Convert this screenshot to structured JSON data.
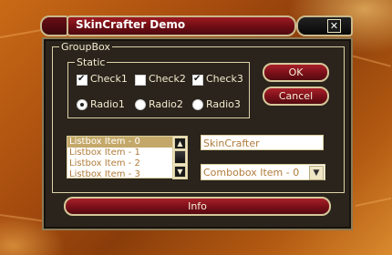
{
  "window": {
    "title": "SkinCrafter Demo"
  },
  "groupbox": {
    "label": "GroupBox"
  },
  "static": {
    "label": "Static"
  },
  "checkboxes": [
    {
      "label": "Check1",
      "checked": true
    },
    {
      "label": "Check2",
      "checked": false
    },
    {
      "label": "Check3",
      "checked": true
    }
  ],
  "radios": [
    {
      "label": "Radio1",
      "selected": true
    },
    {
      "label": "Radio2",
      "selected": false
    },
    {
      "label": "Radio3",
      "selected": false
    }
  ],
  "buttons": {
    "ok": "OK",
    "cancel": "Cancel",
    "info": "Info"
  },
  "listbox": {
    "items": [
      "Listbox Item - 0",
      "Listbox Item - 1",
      "Listbox Item - 2",
      "Listbox Item - 3"
    ],
    "selected_index": 0
  },
  "edit": {
    "value": "SkinCrafter"
  },
  "combobox": {
    "value": "Combobox Item - 0"
  },
  "icons": {
    "close": "close-icon",
    "scroll_up": "arrow-up-icon",
    "scroll_down": "arrow-down-icon",
    "combo_arrow": "chevron-down-icon"
  },
  "colors": {
    "accent_red": "#8a141c",
    "frame_gold": "#d6c79a",
    "body_bg": "#2a241c"
  }
}
